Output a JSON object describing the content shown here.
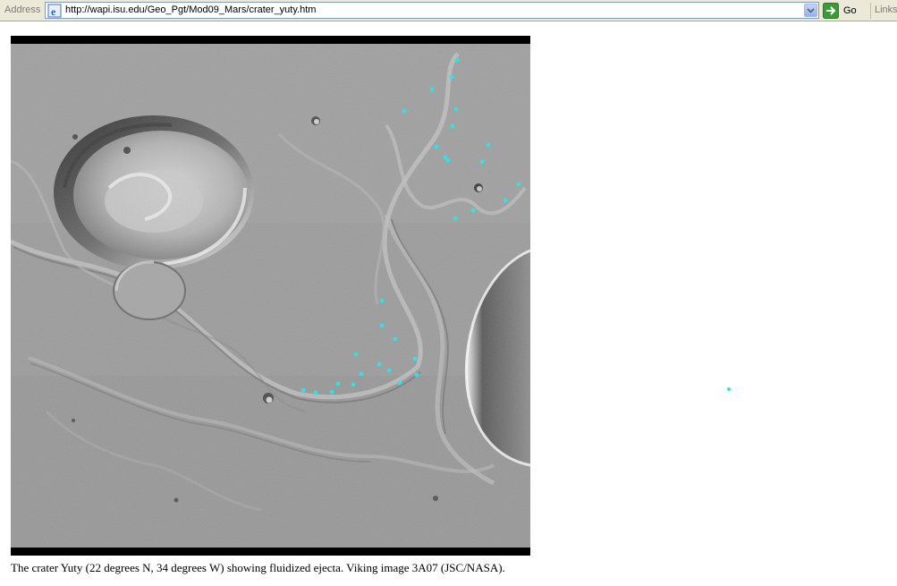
{
  "browser": {
    "address_label": "Address",
    "url": "http://wapi.isu.edu/Geo_Pgt/Mod09_Mars/crater_yuty.htm",
    "go_label": "Go",
    "links_label": "Links"
  },
  "page": {
    "caption": "The crater Yuty (22 degrees N, 34 degrees W) showing fluidized ejecta.  Viking image 3A07 (JSC/NASA).",
    "marker_color": "#33e0e6"
  }
}
